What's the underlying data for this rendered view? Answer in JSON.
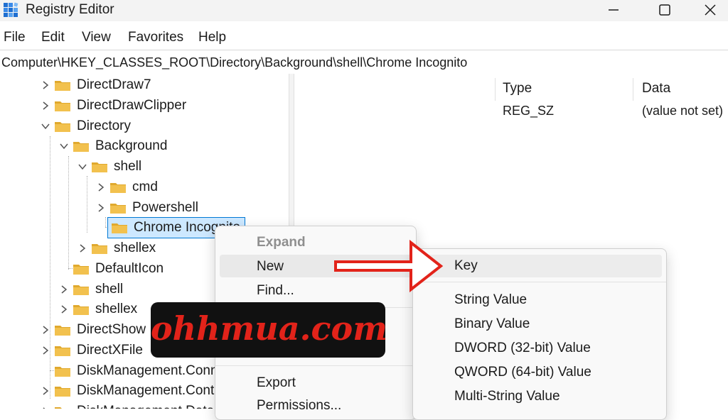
{
  "window": {
    "title": "Registry Editor",
    "icon": "registry-editor-icon",
    "controls": [
      "minimize-icon",
      "maximize-icon",
      "close-icon"
    ]
  },
  "menubar": [
    "File",
    "Edit",
    "View",
    "Favorites",
    "Help"
  ],
  "address": "Computer\\HKEY_CLASSES_ROOT\\Directory\\Background\\shell\\Chrome Incognito",
  "tree": [
    {
      "label": "DirectDraw7",
      "expander": "collapsed"
    },
    {
      "label": "DirectDrawClipper",
      "expander": "collapsed"
    },
    {
      "label": "Directory",
      "expander": "expanded"
    },
    {
      "label": "Background",
      "expander": "expanded"
    },
    {
      "label": "shell",
      "expander": "expanded"
    },
    {
      "label": "cmd",
      "expander": "collapsed"
    },
    {
      "label": "Powershell",
      "expander": "collapsed"
    },
    {
      "label": "Chrome Incognito",
      "expander": "none",
      "selected": true
    },
    {
      "label": "shellex",
      "expander": "collapsed"
    },
    {
      "label": "DefaultIcon",
      "expander": "none"
    },
    {
      "label": "shell",
      "expander": "collapsed"
    },
    {
      "label": "shellex",
      "expander": "collapsed"
    },
    {
      "label": "DirectShow",
      "expander": "collapsed"
    },
    {
      "label": "DirectXFile",
      "expander": "collapsed"
    },
    {
      "label": "DiskManagement.Conn",
      "expander": "none"
    },
    {
      "label": "DiskManagement.Cont",
      "expander": "collapsed"
    },
    {
      "label": "DiskManagement.Data",
      "expander": "collapsed"
    }
  ],
  "values": {
    "headers": {
      "type": "Type",
      "data": "Data"
    },
    "rows": [
      {
        "type": "REG_SZ",
        "data": "(value not set)"
      }
    ]
  },
  "context_menu": {
    "items": [
      {
        "label": "Expand",
        "disabled": true
      },
      {
        "label": "New",
        "hover": true,
        "has_submenu": true
      },
      {
        "label": "Find..."
      },
      {
        "label": "Export"
      },
      {
        "label": "Permissions..."
      }
    ]
  },
  "submenu": {
    "items": [
      "Key",
      "String Value",
      "Binary Value",
      "DWORD (32-bit) Value",
      "QWORD (64-bit) Value",
      "Multi-String Value"
    ]
  },
  "watermark": "ohhmua.com",
  "colors": {
    "folder": "#f2c14e",
    "selection": "#cde8ff",
    "accent": "#0078d4",
    "annotation_arrow": "#e2231a",
    "watermark_bg": "#111111"
  }
}
